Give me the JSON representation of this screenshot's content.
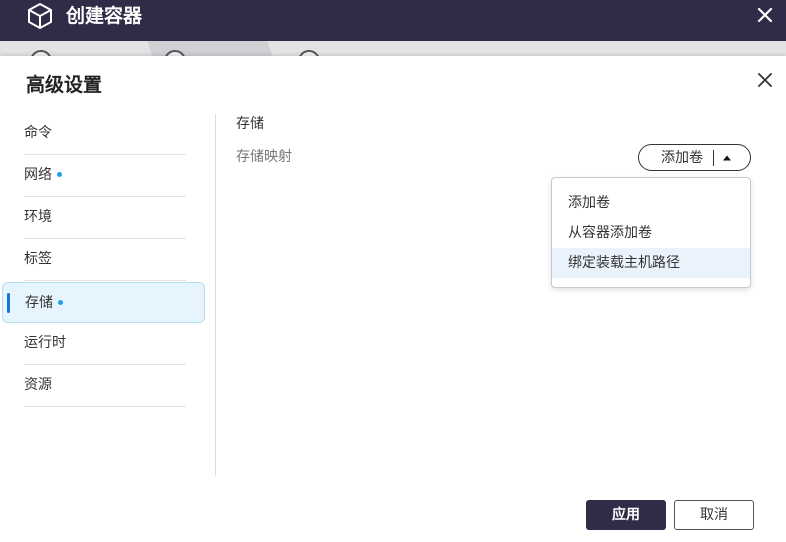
{
  "window": {
    "title": "创建容器",
    "icon": "cube-icon",
    "close_icon": "close-icon"
  },
  "dialog": {
    "title": "高级设置",
    "close_icon": "close-icon"
  },
  "nav": {
    "items": [
      {
        "label": "命令",
        "active": false,
        "indicator": false
      },
      {
        "label": "网络",
        "active": false,
        "indicator": true
      },
      {
        "label": "环境",
        "active": false,
        "indicator": false
      },
      {
        "label": "标签",
        "active": false,
        "indicator": false
      },
      {
        "label": "存储",
        "active": true,
        "indicator": true
      },
      {
        "label": "运行时",
        "active": false,
        "indicator": false
      },
      {
        "label": "资源",
        "active": false,
        "indicator": false
      }
    ]
  },
  "storage": {
    "section_title": "存储",
    "mapping_label": "存储映射",
    "add_button_label": "添加卷",
    "add_button_icon": "caret-up-icon",
    "menu": [
      {
        "label": "添加卷",
        "highlighted": false
      },
      {
        "label": "从容器添加卷",
        "highlighted": false
      },
      {
        "label": "绑定装载主机路径",
        "highlighted": true
      }
    ]
  },
  "footer": {
    "apply_label": "应用",
    "cancel_label": "取消"
  },
  "colors": {
    "titlebar": "#2f2c47",
    "accent": "#1a75d2",
    "indicator_dot": "#1ea0e8",
    "active_nav_bg": "#e6f5fd",
    "menu_hover_bg": "#eaf3fb"
  }
}
